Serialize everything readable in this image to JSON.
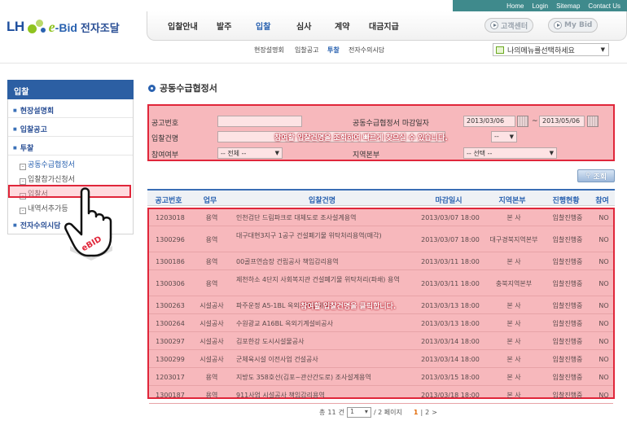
{
  "header": {
    "logo_lh": "LH",
    "logo_ebid_e": "e",
    "logo_ebid_rest": "-Bid",
    "logo_korean": "전자조달",
    "util_links": [
      "Home",
      "Login",
      "Sitemap",
      "Contact Us"
    ],
    "nav_items": [
      "입찰안내",
      "발주",
      "입찰",
      "심사",
      "계약",
      "대금지급"
    ],
    "nav_active": "입찰",
    "btn_customer": "고객센터",
    "btn_mybid": "My Bid",
    "subnav": [
      "현장설명회",
      "입찰공고",
      "투찰",
      "전자수의시담"
    ],
    "subnav_active": "투찰",
    "mymenu_label": "나의메뉴를선택하세요"
  },
  "sidebar": {
    "title": "입찰",
    "items": [
      "현장설명회",
      "입찰공고",
      "투찰"
    ],
    "sub_items": [
      "공동수급협정서",
      "입찰참가신청서",
      "입찰서",
      "내역서추가등"
    ],
    "last_item": "전자수의시담"
  },
  "page": {
    "title": "공동수급협정서",
    "search": {
      "label_notice_no": "공고번호",
      "label_deadline": "공동수급협정서 마감일자",
      "date_from": "2013/03/06",
      "date_sep": "~",
      "date_to": "2013/05/06",
      "label_bid_name": "입찰건명",
      "label_participate": "참여여부",
      "participate_value": "-- 전체 --",
      "label_region": "지역본부",
      "region_value": "-- 선택 --",
      "hidden_select_value": "--",
      "tip": "참여할 입찰건명을 조회하여 빠르게 찾으실 수 있습니다."
    },
    "search_button": "조회",
    "table": {
      "headers": [
        "공고번호",
        "업무",
        "입찰건명",
        "마감일시",
        "지역본부",
        "진행현황",
        "참여"
      ],
      "rows": [
        [
          "1203018",
          "용역",
          "인천검단 드림파크로 대체도로 조사설계용역",
          "2013/03/07 18:00",
          "본 사",
          "입찰진행중",
          "NO"
        ],
        [
          "1300296",
          "용역",
          "대구대현3지구 1공구 건설폐기물 위탁처리용역(매각)",
          "2013/03/07 18:00",
          "대구경북지역본부",
          "입찰진행중",
          "NO"
        ],
        [
          "1300186",
          "용역",
          "00골프연습장 건립공사 책임감리용역",
          "2013/03/11 18:00",
          "본 사",
          "입찰진행중",
          "NO"
        ],
        [
          "1300306",
          "용역",
          "제천하소 4단지 사회복지관 건설폐기물 위탁처리(파쇄) 용역",
          "2013/03/11 18:00",
          "충북지역본부",
          "입찰진행중",
          "NO"
        ],
        [
          "1300263",
          "시설공사",
          "파주운정 A5-1BL 옥외기계설비공사",
          "2013/03/13 18:00",
          "본 사",
          "입찰진행중",
          "NO"
        ],
        [
          "1300264",
          "시설공사",
          "수원광교 A16BL 옥외기계설비공사",
          "2013/03/13 18:00",
          "본 사",
          "입찰진행중",
          "NO"
        ],
        [
          "1300297",
          "시설공사",
          "김포한강 도시시설물공사",
          "2013/03/14 18:00",
          "본 사",
          "입찰진행중",
          "NO"
        ],
        [
          "1300299",
          "시설공사",
          "군체육시설 이전사업 건설공사",
          "2013/03/14 18:00",
          "본 사",
          "입찰진행중",
          "NO"
        ],
        [
          "1203017",
          "용역",
          "지방도 358호선(김포~관산간도로) 조사설계용역",
          "2013/03/15 18:00",
          "본 사",
          "입찰진행중",
          "NO"
        ],
        [
          "1300187",
          "용역",
          "911사업 시설공사 책임감리용역",
          "2013/03/18 18:00",
          "본 사",
          "입찰진행중",
          "NO"
        ]
      ],
      "tip": "참여할 입찰건명을 클릭합니다."
    },
    "pager": {
      "total_prefix": "총",
      "total_count": "11",
      "total_suffix": "건",
      "page_select": "1",
      "page_of": "/ 2 페이지",
      "current_page": "1",
      "sep": "|",
      "next_page": "2",
      "arrow": ">"
    }
  },
  "overlay": {
    "hand_label": "eBID"
  },
  "colors": {
    "accent_blue": "#2a62b0",
    "highlight_red": "#e0263a",
    "highlight_fill": "#f7b8bc"
  }
}
